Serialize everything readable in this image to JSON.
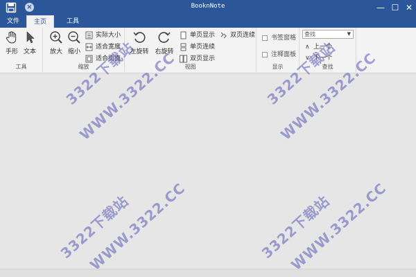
{
  "app": {
    "title": "BooknNote"
  },
  "titlebar": {
    "minimize": "—",
    "maximize": "☐",
    "close": "✕",
    "quick_close": "×"
  },
  "tabs": [
    {
      "label": "文件"
    },
    {
      "label": "主页"
    },
    {
      "label": "工具"
    }
  ],
  "ribbon": {
    "tools_group": {
      "label": "工具",
      "hand": "手形",
      "text": "文本"
    },
    "zoom_group": {
      "label": "缩放",
      "zoom_in": "放大",
      "zoom_out": "缩小",
      "actual_size": "实际大小",
      "fit_width": "适合宽度",
      "fit_page": "适合页面"
    },
    "view_group": {
      "label": "视图",
      "rotate_left": "左旋转",
      "rotate_right": "右旋转",
      "single_page": "单页显示",
      "single_continuous": "单页连续",
      "double_page": "双页显示",
      "double_continuous": "双页连续"
    },
    "display_group": {
      "label": "显示",
      "bookmark_pane": "书签窗格",
      "annotation_pane": "注释面板"
    },
    "search_group": {
      "label": "查找",
      "placeholder": "查找",
      "arrow": "▼",
      "prev": "上一个",
      "next": "下一个",
      "prev_icon": "∧",
      "next_icon": "∨"
    }
  },
  "watermarks": [
    "3322下载站",
    "WWW.3322.CC",
    "3322下载站",
    "WWW.3322.CC",
    "3322下载站",
    "WWW.3322.CC",
    "3322下载站",
    "WWW.3322.CC"
  ]
}
